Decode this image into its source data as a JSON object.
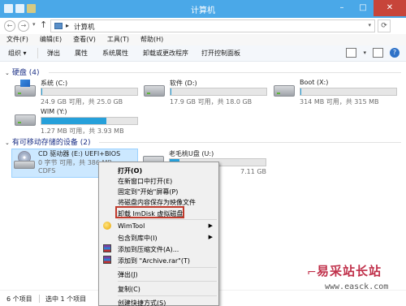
{
  "window": {
    "title": "计算机",
    "minimize": "–",
    "maximize": "□",
    "close": "✕"
  },
  "address": {
    "path_root": "▸",
    "path": "计算机",
    "dropdown": "▾",
    "refresh": "⟳"
  },
  "nav": {
    "back": "←",
    "forward": "→",
    "dropdown": "▾",
    "up": "↑"
  },
  "menubar": [
    "文件(F)",
    "编辑(E)",
    "查看(V)",
    "工具(T)",
    "帮助(H)"
  ],
  "toolbar": {
    "organize": "组织 ▾",
    "eject": "弹出",
    "properties": "属性",
    "system_properties": "系统属性",
    "uninstall": "卸载或更改程序",
    "control_panel": "打开控制面板",
    "view_dropdown": "▾",
    "help": "?"
  },
  "sections": {
    "hard_disks": "硬盘 (4)",
    "removable": "有可移动存储的设备 (2)",
    "chevron": "⌄"
  },
  "drives": [
    {
      "name": "系统 (C:)",
      "info": "24.9 GB 可用，共 25.0 GB",
      "used_percent": 1,
      "icon": "windows-drive-icon"
    },
    {
      "name": "软件 (D:)",
      "info": "17.9 GB 可用，共 18.0 GB",
      "used_percent": 1,
      "icon": "hard-drive-icon"
    },
    {
      "name": "Boot (X:)",
      "info": "314 MB 可用，共 315 MB",
      "used_percent": 1,
      "icon": "hard-drive-icon"
    },
    {
      "name": "WIM (Y:)",
      "info": "1.27 MB 可用，共 3.93 MB",
      "used_percent": 68,
      "icon": "hard-drive-icon"
    }
  ],
  "removable_drives": [
    {
      "name": "CD 驱动器 (E:) UEFI+BIOS",
      "info": "0 字节 可用，共 386 MB",
      "fs": "CDFS",
      "used_percent": 100,
      "icon": "cd-drive-icon"
    },
    {
      "name": "老毛桃U盘 (U:)",
      "info": "7.11 GB",
      "used_percent": 10,
      "icon": "usb-drive-icon"
    }
  ],
  "context_menu": [
    {
      "label": "打开(O)",
      "bold": true
    },
    {
      "label": "在新窗口中打开(E)"
    },
    {
      "label": "固定到\"开始\"屏幕(P)"
    },
    {
      "label": "将磁盘内容保存为映像文件"
    },
    {
      "label": "卸载 ImDisk 虚拟磁盘",
      "highlighted": true
    },
    {
      "label": "WimTool",
      "submenu": true,
      "icon": "wimtool-icon"
    },
    {
      "label": "包含到库中(I)",
      "submenu": true
    },
    {
      "label": "添加到压缩文件(A)...",
      "icon": "winrar-icon"
    },
    {
      "label": "添加到 \"Archive.rar\"(T)",
      "icon": "winrar-icon"
    },
    {
      "label": "弹出(J)"
    },
    {
      "label": "复制(C)"
    },
    {
      "label": "创建快捷方式(S)"
    }
  ],
  "submenu_arrow": "▶",
  "status": {
    "item_count": "6 个项目",
    "selected": "选中 1 个项目"
  },
  "watermark": {
    "title": "易采站长站",
    "url": "www.easck.com",
    "mark": "⌐"
  }
}
